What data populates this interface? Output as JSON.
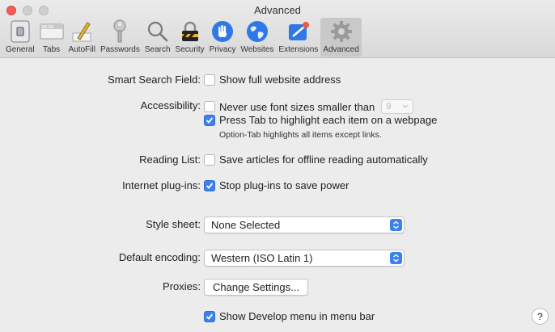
{
  "window": {
    "title": "Advanced",
    "accent_color": "#3b82f0"
  },
  "toolbar": {
    "items": [
      {
        "label": "General",
        "icon": "general-switch-icon"
      },
      {
        "label": "Tabs",
        "icon": "tabs-icon"
      },
      {
        "label": "AutoFill",
        "icon": "pencil-icon"
      },
      {
        "label": "Passwords",
        "icon": "key-icon"
      },
      {
        "label": "Search",
        "icon": "magnifier-icon"
      },
      {
        "label": "Security",
        "icon": "lock-icon"
      },
      {
        "label": "Privacy",
        "icon": "hand-icon"
      },
      {
        "label": "Websites",
        "icon": "globe-icon"
      },
      {
        "label": "Extensions",
        "icon": "puzzle-icon"
      },
      {
        "label": "Advanced",
        "icon": "gear-icon",
        "selected": true
      }
    ]
  },
  "settings": {
    "smart_search": {
      "label": "Smart Search Field:",
      "option": "Show full website address",
      "checked": false
    },
    "accessibility": {
      "label": "Accessibility:",
      "option1": "Never use font sizes smaller than",
      "option1_checked": false,
      "font_size": "9",
      "option2": "Press Tab to highlight each item on a webpage",
      "option2_checked": true,
      "note": "Option-Tab highlights all items except links."
    },
    "reading_list": {
      "label": "Reading List:",
      "option": "Save articles for offline reading automatically",
      "checked": false
    },
    "plugins": {
      "label": "Internet plug-ins:",
      "option": "Stop plug-ins to save power",
      "checked": true
    },
    "style_sheet": {
      "label": "Style sheet:",
      "value": "None Selected"
    },
    "encoding": {
      "label": "Default encoding:",
      "value": "Western (ISO Latin 1)"
    },
    "proxies": {
      "label": "Proxies:",
      "button": "Change Settings..."
    },
    "develop_menu": {
      "option": "Show Develop menu in menu bar",
      "checked": true
    }
  },
  "help": {
    "label": "?"
  }
}
